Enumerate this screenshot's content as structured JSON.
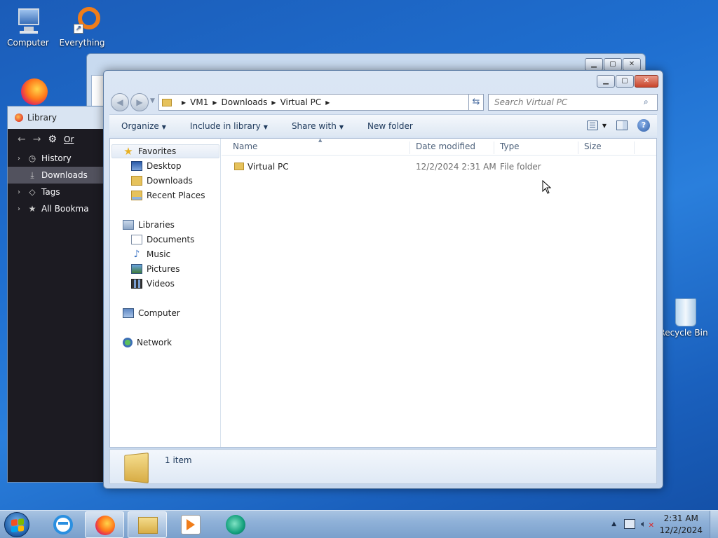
{
  "desktop": {
    "icons": [
      {
        "label": "Computer"
      },
      {
        "label": "Everything"
      },
      {
        "label": "Recycle Bin"
      }
    ]
  },
  "library": {
    "title": "Library",
    "toolbar_organize": "Or",
    "items": [
      {
        "label": "History",
        "icon": "clock-icon"
      },
      {
        "label": "Downloads",
        "icon": "download-icon",
        "selected": true
      },
      {
        "label": "Tags",
        "icon": "tag-icon"
      },
      {
        "label": "All Bookma",
        "icon": "star-icon"
      }
    ]
  },
  "explorer": {
    "breadcrumb": [
      "VM1",
      "Downloads",
      "Virtual PC"
    ],
    "search_placeholder": "Search Virtual PC",
    "commands": {
      "organize": "Organize",
      "include_in_library": "Include in library",
      "share_with": "Share with",
      "new_folder": "New folder"
    },
    "nav": {
      "favorites": "Favorites",
      "desktop": "Desktop",
      "downloads": "Downloads",
      "recent_places": "Recent Places",
      "libraries": "Libraries",
      "documents": "Documents",
      "music": "Music",
      "pictures": "Pictures",
      "videos": "Videos",
      "computer": "Computer",
      "network": "Network"
    },
    "columns": {
      "name": "Name",
      "date_modified": "Date modified",
      "type": "Type",
      "size": "Size"
    },
    "files": [
      {
        "name": "Virtual PC",
        "date_modified": "12/2/2024 2:31 AM",
        "type": "File folder",
        "size": ""
      }
    ],
    "status": "1 item"
  },
  "taskbar": {
    "time": "2:31 AM",
    "date": "12/2/2024"
  },
  "colors": {
    "desktop_blue": "#1f6fd0",
    "library_dark": "#1c1b22",
    "close_red": "#c8452b"
  }
}
